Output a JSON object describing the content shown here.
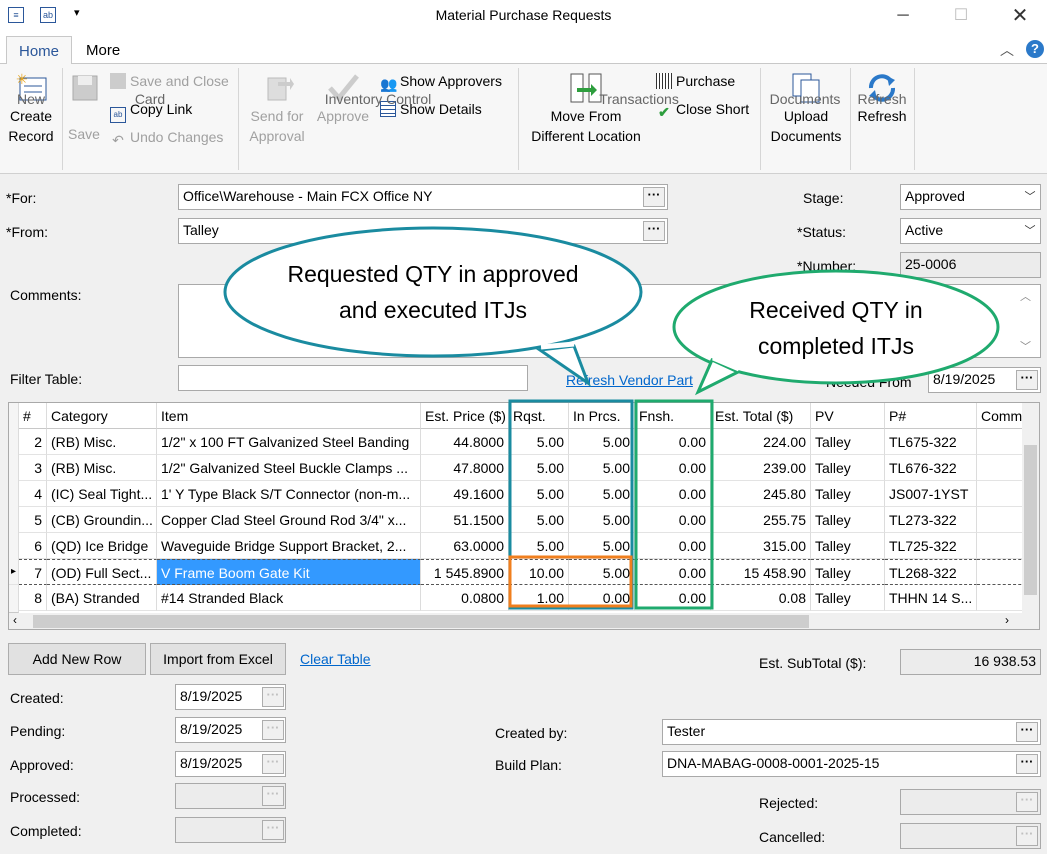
{
  "window": {
    "title": "Material Purchase Requests"
  },
  "tabs": [
    {
      "label": "Home"
    },
    {
      "label": "More"
    }
  ],
  "ribbon": {
    "create_record": "Create Record",
    "create_record_l1": "Create",
    "create_record_l2": "Record",
    "group_new": "New",
    "save": "Save",
    "save_and_close": "Save and Close",
    "copy_link": "Copy Link",
    "undo_changes": "Undo Changes",
    "group_card": "Card",
    "send_for_approval_l1": "Send for",
    "send_for_approval_l2": "Approval",
    "approve": "Approve",
    "show_approvers": "Show Approvers",
    "show_details": "Show Details",
    "group_inventory": "Inventory Control",
    "move_l1": "Move From",
    "move_l2": "Different Location",
    "purchase": "Purchase",
    "close_short": "Close Short",
    "group_transactions": "Transactions",
    "upload_l1": "Upload",
    "upload_l2": "Documents",
    "group_documents": "Documents",
    "refresh": "Refresh",
    "group_refresh": "Refresh"
  },
  "form": {
    "for_label": "*For:",
    "for_value": "Office\\Warehouse - Main FCX Office NY",
    "from_label": "*From:",
    "from_value": "Talley",
    "comments_label": "Comments:",
    "filter_label": "Filter Table:",
    "filter_value": "",
    "refresh_vendor_part": "Refresh Vendor Part",
    "stage_label": "Stage:",
    "stage_value": "Approved",
    "status_label": "*Status:",
    "status_value": "Active",
    "number_label": "*Number:",
    "number_value": "25-0006",
    "needed_label": "Needed From",
    "needed_value": "8/19/2025"
  },
  "grid": {
    "columns": [
      "#",
      "Category",
      "Item",
      "Est. Price ($)",
      "Rqst.",
      "In Prcs.",
      "Fnsh.",
      "Est. Total ($)",
      "PV",
      "P#",
      "Comm"
    ],
    "rows": [
      [
        "2",
        "(RB) Misc.",
        "1/2\" x 100 FT Galvanized Steel Banding",
        "44.8000",
        "5.00",
        "5.00",
        "0.00",
        "224.00",
        "Talley",
        "TL675-322",
        ""
      ],
      [
        "3",
        "(RB) Misc.",
        "1/2\" Galvanized Steel Buckle Clamps ...",
        "47.8000",
        "5.00",
        "5.00",
        "0.00",
        "239.00",
        "Talley",
        "TL676-322",
        ""
      ],
      [
        "4",
        "(IC) Seal Tight...",
        "1' Y Type Black S/T Connector (non-m...",
        "49.1600",
        "5.00",
        "5.00",
        "0.00",
        "245.80",
        "Talley",
        "JS007-1YST",
        ""
      ],
      [
        "5",
        "(CB) Groundin...",
        "Copper Clad Steel Ground Rod 3/4\" x...",
        "51.1500",
        "5.00",
        "5.00",
        "0.00",
        "255.75",
        "Talley",
        "TL273-322",
        ""
      ],
      [
        "6",
        "(QD) Ice Bridge",
        "Waveguide Bridge Support Bracket, 2...",
        "63.0000",
        "5.00",
        "5.00",
        "0.00",
        "315.00",
        "Talley",
        "TL725-322",
        ""
      ],
      [
        "7",
        "(OD) Full Sect...",
        "V Frame Boom Gate Kit",
        "1 545.8900",
        "10.00",
        "5.00",
        "0.00",
        "15 458.90",
        "Talley",
        "TL268-322",
        ""
      ],
      [
        "8",
        "(BA) Stranded",
        "#14 Stranded Black",
        "0.0800",
        "1.00",
        "0.00",
        "0.00",
        "0.08",
        "Talley",
        "THHN 14 S...",
        ""
      ]
    ],
    "selected_row_marker": "▸"
  },
  "actions": {
    "add_new_row": "Add New Row",
    "import_excel": "Import from Excel",
    "clear_table": "Clear Table",
    "subtotal_label": "Est. SubTotal ($):",
    "subtotal_value": "16 938.53"
  },
  "dates": {
    "created_label": "Created:",
    "created_value": "8/19/2025",
    "pending_label": "Pending:",
    "pending_value": "8/19/2025",
    "approved_label": "Approved:",
    "approved_value": "8/19/2025",
    "processed_label": "Processed:",
    "processed_value": "",
    "completed_label": "Completed:",
    "completed_value": "",
    "created_by_label": "Created by:",
    "created_by_value": "Tester",
    "build_plan_label": "Build Plan:",
    "build_plan_value": "DNA-MABAG-0008-0001-2025-15",
    "rejected_label": "Rejected:",
    "rejected_value": "",
    "cancelled_label": "Cancelled:",
    "cancelled_value": ""
  },
  "callouts": {
    "requested_l1": "Requested QTY in approved",
    "requested_l2": "and executed ITJs",
    "received_l1": "Received QTY in",
    "received_l2": "completed ITJs"
  },
  "colors": {
    "teal": "#1a8ba0",
    "green": "#1faa6e",
    "orange": "#f07f1e",
    "accent": "#2b579a"
  }
}
